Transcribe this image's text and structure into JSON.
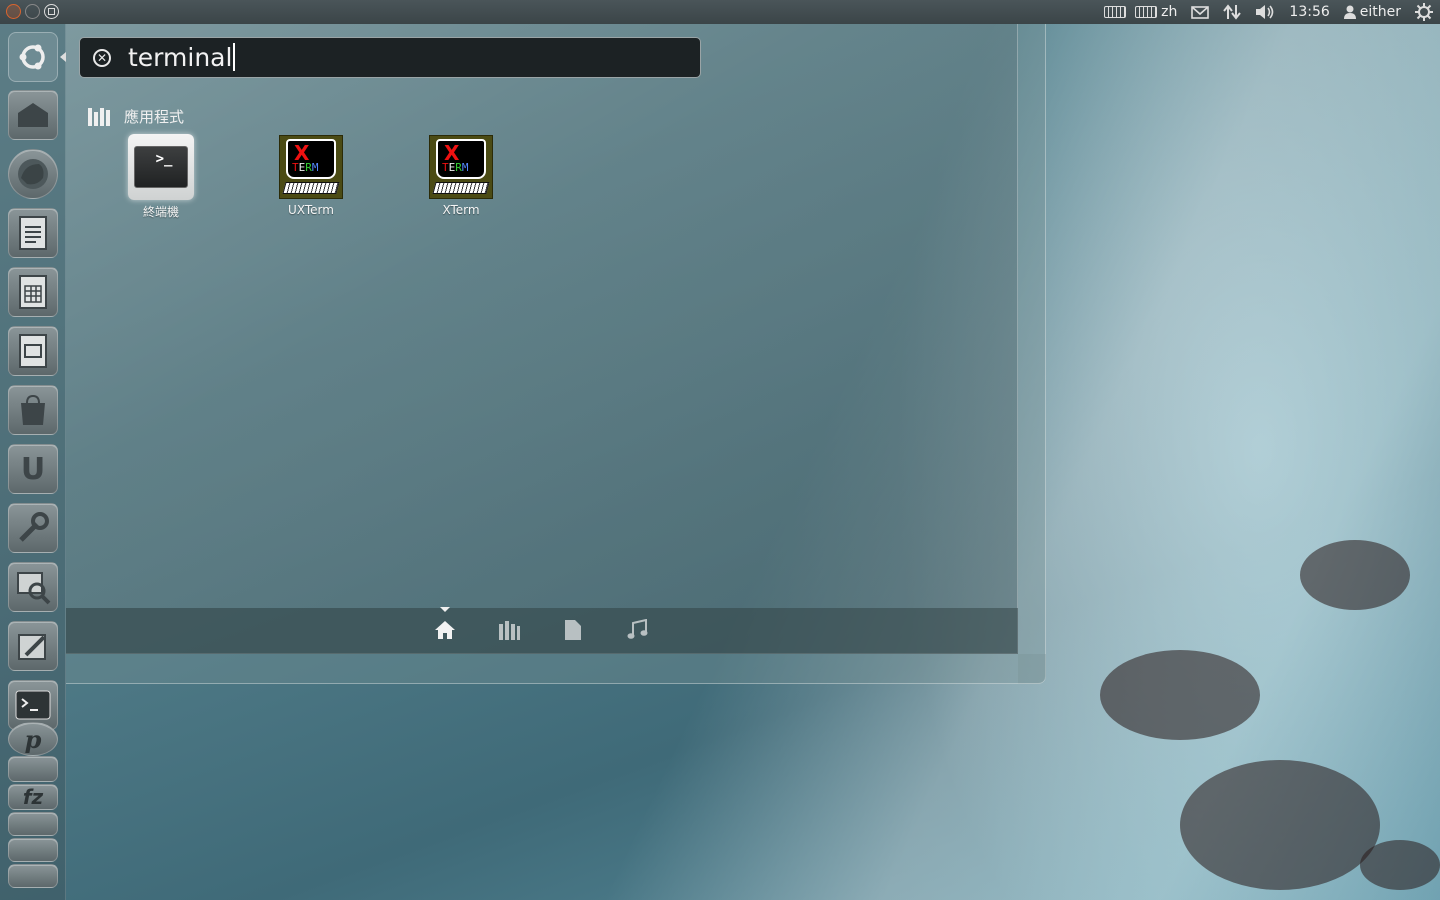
{
  "top_panel": {
    "language": "zh",
    "clock": "13:56",
    "user": "either"
  },
  "dash": {
    "search": {
      "query": "terminal"
    },
    "category": {
      "label": "應用程式"
    },
    "apps": [
      {
        "label": "終端機",
        "icon": "terminal-icon"
      },
      {
        "label": "UXTerm",
        "icon": "xterm-icon"
      },
      {
        "label": "XTerm",
        "icon": "xterm-icon"
      }
    ],
    "lenses": [
      "home-lens-icon",
      "applications-lens-icon",
      "files-lens-icon",
      "music-lens-icon"
    ],
    "active_lens": "home-lens-icon"
  },
  "launcher": {
    "items": [
      "home-folder-icon",
      "firefox-icon",
      "writer-icon",
      "calc-icon",
      "impress-icon",
      "software-center-icon",
      "ubuntu-one-icon",
      "system-settings-icon",
      "image-viewer-icon",
      "text-editor-icon",
      "terminal-icon",
      "pidgin-icon",
      "filezilla-icon",
      "workspace-switcher-icon",
      "trash-icon"
    ]
  },
  "colors": {
    "panel": "#3b4548",
    "accent": "#d9642e"
  }
}
